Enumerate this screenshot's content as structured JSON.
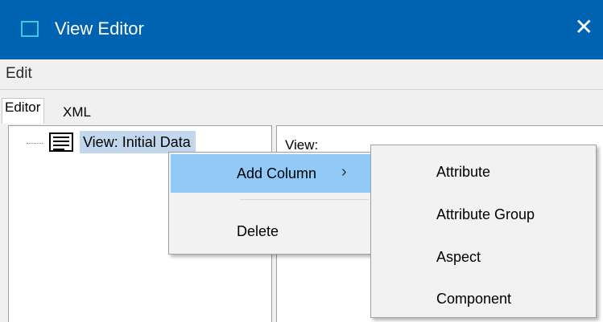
{
  "window": {
    "title": "View Editor",
    "close_glyph": "✕",
    "app_icon": "window-icon"
  },
  "menubar": {
    "edit_label": "Edit"
  },
  "tabs": {
    "editor_label": "Editor",
    "xml_label": "XML"
  },
  "tree": {
    "node_label": "View: Initial Data",
    "node_icon": "document-lines-icon"
  },
  "properties": {
    "label": "View:"
  },
  "context_menu": {
    "items": [
      {
        "label": "Add Column",
        "arrow": "›"
      },
      {
        "label": "Delete"
      }
    ]
  },
  "submenu": {
    "items": [
      {
        "label": "Attribute"
      },
      {
        "label": "Attribute Group"
      },
      {
        "label": "Aspect"
      },
      {
        "label": "Component"
      }
    ]
  },
  "colors": {
    "titlebar": "#0063b1",
    "selection": "#c0d7ee",
    "menu_highlight": "#91c9f7"
  }
}
